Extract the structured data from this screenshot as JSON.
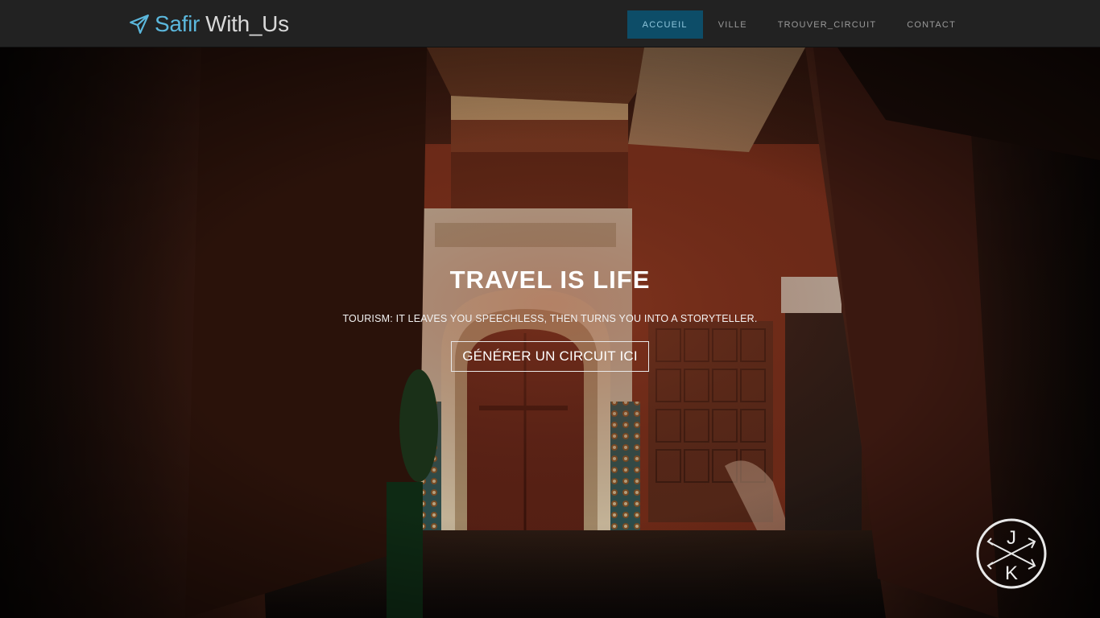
{
  "brand": {
    "part1": "Safir",
    "part2": "With_Us",
    "icon": "paper-plane-icon"
  },
  "nav": {
    "items": [
      {
        "label": "ACCUEIL",
        "active": true
      },
      {
        "label": "VILLE",
        "active": false
      },
      {
        "label": "TROUVER_CIRCUIT",
        "active": false
      },
      {
        "label": "CONTACT",
        "active": false
      }
    ]
  },
  "hero": {
    "title": "TRAVEL IS LIFE",
    "subtitle": "TOURISM: IT LEAVES YOU SPEECHLESS, THEN TURNS YOU INTO A STORYTELLER.",
    "button_label": "GÉNÉRER UN CIRCUIT ICI"
  },
  "badge": {
    "letter_top": "J",
    "letter_bottom": "K",
    "icon": "crossed-arrows-icon"
  },
  "colors": {
    "navbar_bg": "#222222",
    "brand_accent": "#5bb7dc",
    "nav_active_bg": "#0d4d68",
    "nav_text": "#9a9a9a"
  }
}
